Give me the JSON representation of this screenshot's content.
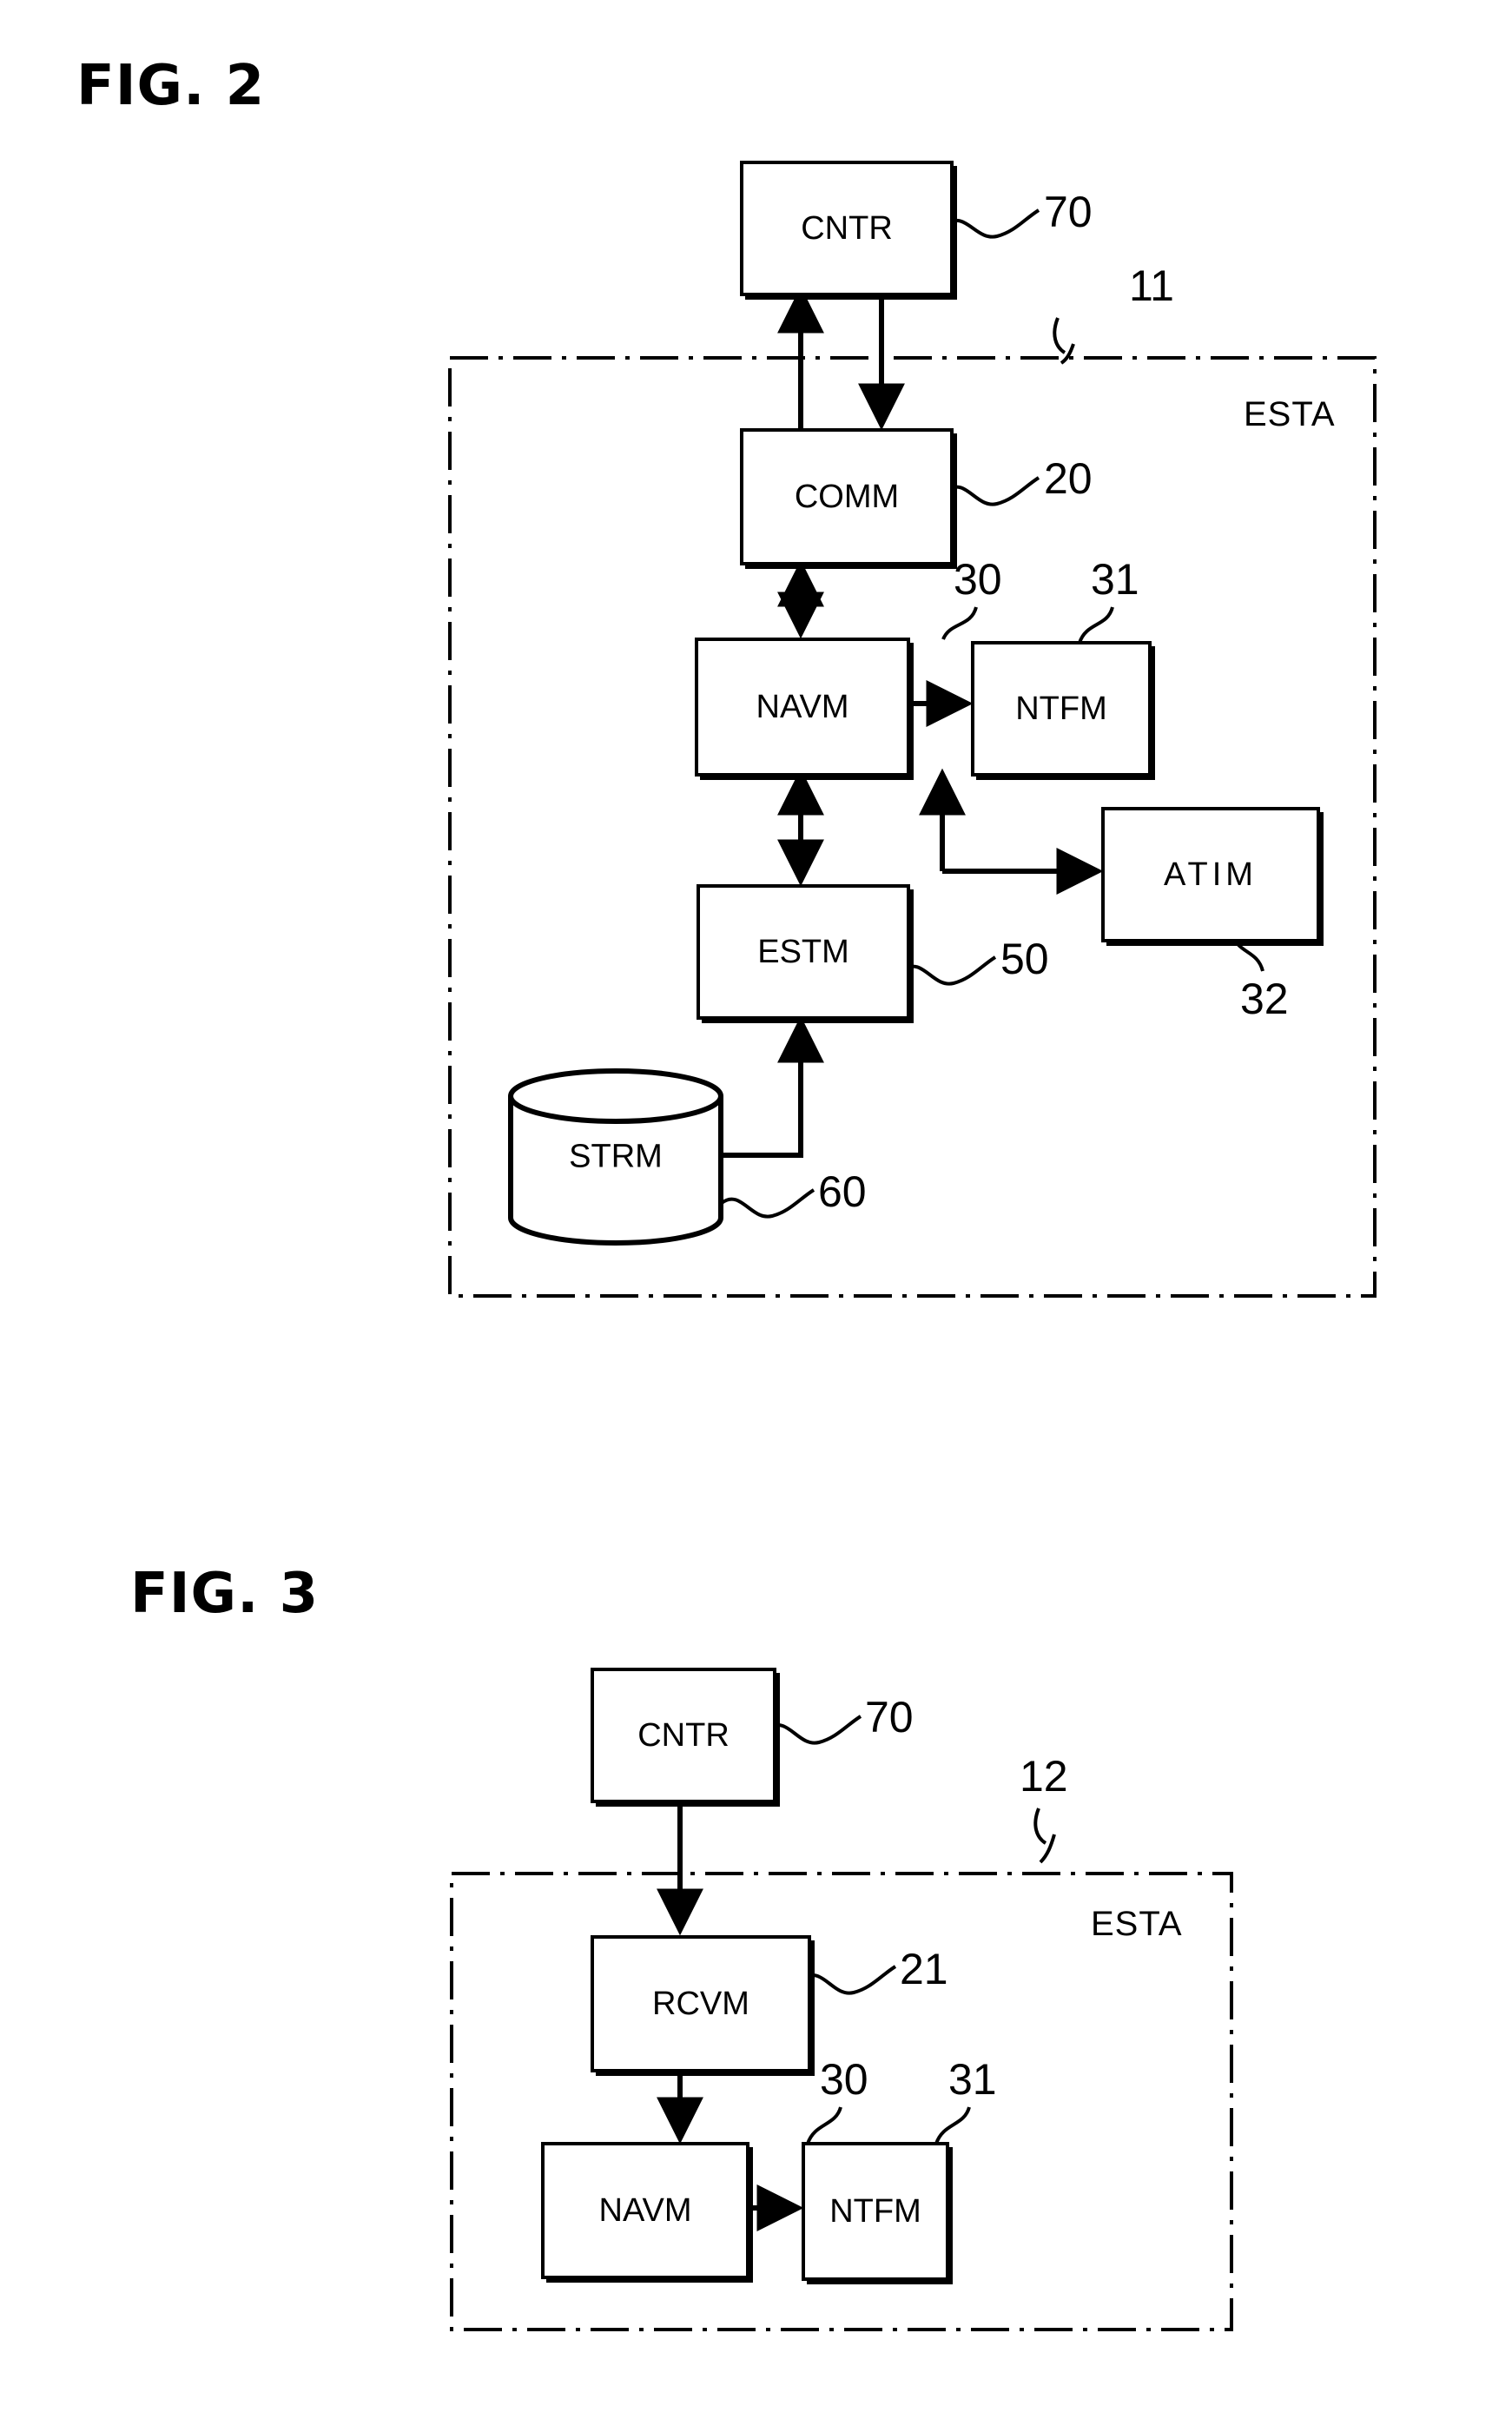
{
  "figures": [
    {
      "title": "FIG. 2",
      "container_label": "ESTA",
      "container_ref": "11",
      "nodes": [
        {
          "key": "cntr",
          "label": "CNTR",
          "ref": "70"
        },
        {
          "key": "comm",
          "label": "COMM",
          "ref": "20"
        },
        {
          "key": "navm",
          "label": "NAVM",
          "ref": "30"
        },
        {
          "key": "ntfm",
          "label": "NTFM",
          "ref": "31"
        },
        {
          "key": "atim",
          "label": "ATIM",
          "ref": "32"
        },
        {
          "key": "estm",
          "label": "ESTM",
          "ref": "50"
        },
        {
          "key": "strm",
          "label": "STRM",
          "ref": "60"
        }
      ]
    },
    {
      "title": "FIG. 3",
      "container_label": "ESTA",
      "container_ref": "12",
      "nodes": [
        {
          "key": "cntr3",
          "label": "CNTR",
          "ref": "70"
        },
        {
          "key": "rcvm3",
          "label": "RCVM",
          "ref": "21"
        },
        {
          "key": "navm3",
          "label": "NAVM",
          "ref": "30"
        },
        {
          "key": "ntfm3",
          "label": "NTFM",
          "ref": "31"
        }
      ]
    }
  ]
}
